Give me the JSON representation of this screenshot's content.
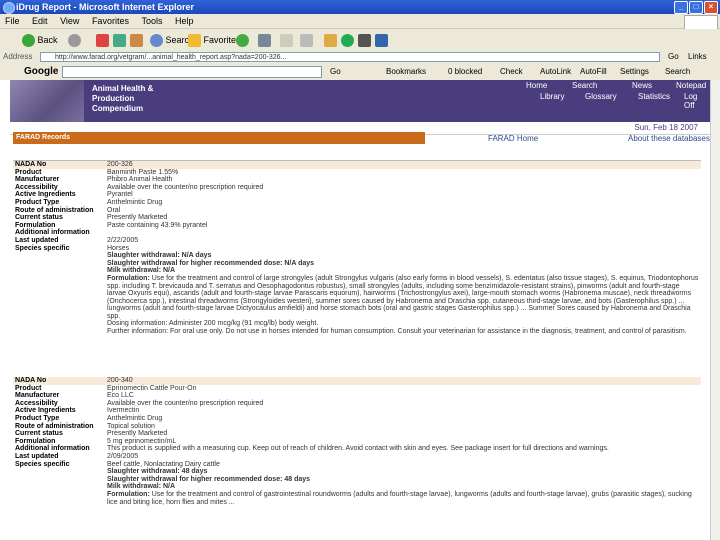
{
  "window": {
    "title": "iDrug Report - Microsoft Internet Explorer",
    "min": "_",
    "max": "□",
    "close": "×"
  },
  "menu": [
    "File",
    "Edit",
    "View",
    "Favorites",
    "Tools",
    "Help"
  ],
  "toolbar": {
    "back": "Back",
    "search": "Search",
    "favorites": "Favorites"
  },
  "address": {
    "label": "Address",
    "url": "http://www.farad.org/vetgram/...animal_health_report.asp?nada=200-326...",
    "go": "Go",
    "links": "Links"
  },
  "google": {
    "logo": "Google",
    "items": [
      "Go",
      "Bookmarks",
      "0 blocked",
      "Check",
      "AutoLink",
      "AutoFill",
      "Settings",
      "Search"
    ]
  },
  "banner": {
    "title": "Animal Health & Production Compendium"
  },
  "nav": {
    "row1": [
      "Home",
      "Search",
      "News",
      "Notepad"
    ],
    "row2": [
      "Library",
      "Glossary",
      "Statistics",
      "Log Off"
    ]
  },
  "subbar": {
    "right": "Sun, Feb 18 2007"
  },
  "section": {
    "title": "FARAD Records",
    "farad_home": "FARAD Home",
    "about": "About these databases"
  },
  "record1": {
    "rows": [
      {
        "k": "NADA No",
        "v": "200-326"
      },
      {
        "k": "Product",
        "v": "Banminth Paste 1.55%"
      },
      {
        "k": "Manufacturer",
        "v": "Phibro Animal Health"
      },
      {
        "k": "Accessibility",
        "v": "Available over the counter/no prescription required"
      },
      {
        "k": "Active Ingredients",
        "v": "Pyrantel"
      },
      {
        "k": "Product Type",
        "v": "Anthelmintic Drug"
      },
      {
        "k": "Route of administration",
        "v": "Oral"
      },
      {
        "k": "Current status",
        "v": "Presently Marketed"
      },
      {
        "k": "Formulation",
        "v": "Paste containing 43.9% pyrantel"
      },
      {
        "k": "Additional information",
        "v": ""
      },
      {
        "k": "Last updated",
        "v": "2/22/2005"
      }
    ],
    "species_label": "Species specific",
    "species": "Horses",
    "withdrawal": "Slaughter withdrawal: N/A days",
    "withdrawal_dose": "Slaughter withdrawal for higher recommended dose: N/A days",
    "milk": "Milk withdrawal: N/A",
    "formulation_label": "Formulation:",
    "formulation_text": "Use for the treatment and control of large strongyles (adult Strongylus vulgaris (also early forms in blood vessels), S. edentatus (also tissue stages), S. equinus, Triodontophorus spp. including T. brevicauda and T. serratus and Oesophagodontus robustus), small strongyles (adults, including some benzimidazole-resistant strains), pinworms (adult and fourth-stage larvae Oxyuris equi), ascarids (adult and fourth-stage larvae Parascaris equorum), hairworms (Trichostrongylus axei), large-mouth stomach worms (Habronema muscae), neck threadworms (Onchocerca spp.), intestinal threadworms (Strongyloides westeri), summer sores caused by Habronema and Draschia spp. cutaneous third-stage larvae, and bots (Gasterophilus spp.) ... lungworms (adult and fourth-stage larvae Dictyocaulus arnfieldi) and horse stomach bots (oral and gastric stages Gasterophilus spp.) ... Summer Sores caused by Habronema and Draschia spp.",
    "dosing": "Dosing information: Administer 200 mcg/kg (91 mcg/lb) body weight.",
    "further": "Further information: For oral use only. Do not use in horses intended for human consumption. Consult your veterinarian for assistance in the diagnosis, treatment, and control of parasitism."
  },
  "record2": {
    "rows": [
      {
        "k": "NADA No",
        "v": "200-340"
      },
      {
        "k": "Product",
        "v": "Eprinomectin Cattle Pour-On"
      },
      {
        "k": "Manufacturer",
        "v": "Eco LLC"
      },
      {
        "k": "Accessibility",
        "v": "Available over the counter/no prescription required"
      },
      {
        "k": "Active Ingredients",
        "v": "Ivermectin"
      },
      {
        "k": "Product Type",
        "v": "Anthelmintic Drug"
      },
      {
        "k": "Route of administration",
        "v": "Topical solution"
      },
      {
        "k": "Current status",
        "v": "Presently Marketed"
      },
      {
        "k": "Formulation",
        "v": "5 mg eprinomectin/mL"
      },
      {
        "k": "Additional information",
        "v": "This product is supplied with a measuring cup. Keep out of reach of children. Avoid contact with skin and eyes. See package insert for full directions and warnings."
      },
      {
        "k": "Last updated",
        "v": "2/09/2005"
      }
    ],
    "species_label": "Species specific",
    "species": "Beef cattle, Nonlactating Dairy cattle",
    "withdrawal": "Slaughter withdrawal: 48 days",
    "withdrawal_dose": "Slaughter withdrawal for higher recommended dose: 48 days",
    "milk": "Milk withdrawal: N/A",
    "formulation_label": "Formulation:",
    "formulation_text": "Use for the treatment and control of gastrointestinal roundworms (adults and fourth-stage larvae), lungworms (adults and fourth-stage larvae), grubs (parasitic stages), sucking lice and biting lice, horn flies and mites ..."
  },
  "colors": {
    "title": "#1c47b8",
    "banner": "#4a3d7e",
    "orange": "#c96b1b",
    "band": "#f7ead9"
  }
}
